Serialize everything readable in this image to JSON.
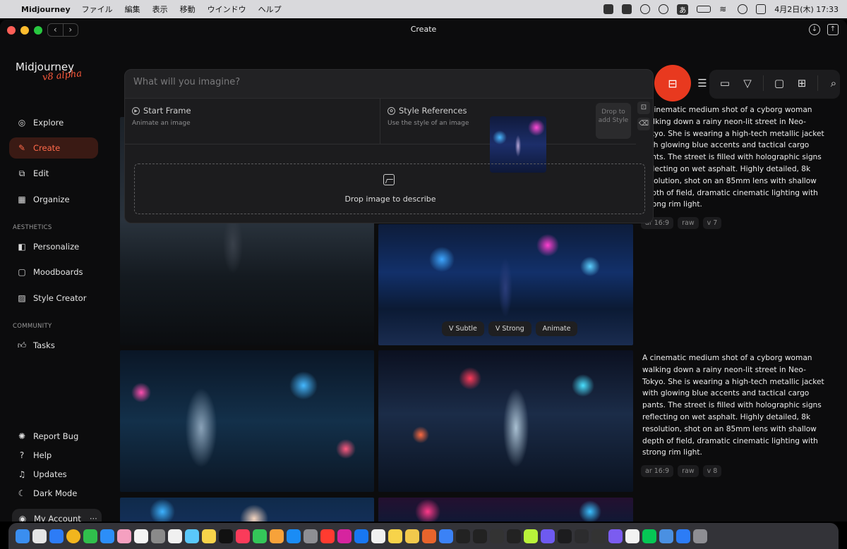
{
  "menubar": {
    "app_name": "Midjourney",
    "menus": [
      "ファイル",
      "編集",
      "表示",
      "移動",
      "ウインドウ",
      "ヘルプ"
    ],
    "input_indicator": "あ",
    "datetime": "4月2日(木)  17:33"
  },
  "window": {
    "title": "Create"
  },
  "sidebar": {
    "logo": "Midjourney",
    "logo_badge": "v8 alpha",
    "main_items": [
      {
        "label": "Explore",
        "icon": "compass-icon"
      },
      {
        "label": "Create",
        "icon": "brush-icon",
        "active": true
      },
      {
        "label": "Edit",
        "icon": "edit-icon"
      },
      {
        "label": "Organize",
        "icon": "grid-icon"
      }
    ],
    "aesthetics_label": "AESTHETICS",
    "aesthetics_items": [
      {
        "label": "Personalize",
        "icon": "personalize-icon"
      },
      {
        "label": "Moodboards",
        "icon": "moodboard-icon"
      },
      {
        "label": "Style Creator",
        "icon": "style-creator-icon"
      }
    ],
    "community_label": "COMMUNITY",
    "community_items": [
      {
        "label": "Tasks",
        "icon": "thumbs-up-icon"
      }
    ],
    "bottom_items": [
      {
        "label": "Report Bug",
        "icon": "bug-icon"
      },
      {
        "label": "Help",
        "icon": "help-icon"
      },
      {
        "label": "Updates",
        "icon": "bell-icon"
      },
      {
        "label": "Dark Mode",
        "icon": "moon-icon"
      }
    ],
    "account": {
      "label": "My Account",
      "more": "···"
    }
  },
  "imagine": {
    "placeholder": "What will you imagine?",
    "start_frame": {
      "title": "Start Frame",
      "subtitle": "Animate an image"
    },
    "style_refs": {
      "title": "Style References",
      "subtitle": "Use the style of an image",
      "drop_label": "Drop to add Style"
    },
    "describe_label": "Drop image to describe"
  },
  "toolbar": {
    "icons": [
      "image-prompt-icon",
      "sliders-icon",
      "folder-icon",
      "filter-icon",
      "chat-icon",
      "grid-view-icon",
      "search-icon"
    ]
  },
  "feed": {
    "prompts": [
      {
        "text": "A cinematic medium shot of a cyborg woman walking down a rainy neon-lit street in Neo-Tokyo. She is wearing a high-tech metallic jacket with glowing blue accents and tactical cargo pants. The street is filled with holographic signs reflecting on wet asphalt. Highly detailed, 8k resolution, shot on an 85mm lens with shallow depth of field, dramatic cinematic lighting with strong rim light.",
        "tags": [
          "ar 16:9",
          "raw",
          "v 7"
        ]
      },
      {
        "text": "A cinematic medium shot of a cyborg woman walking down a rainy neon-lit street in Neo-Tokyo. She is wearing a high-tech metallic jacket with glowing blue accents and tactical cargo pants. The street is filled with holographic signs reflecting on wet asphalt. Highly detailed, 8k resolution, shot on an 85mm lens with shallow depth of field, dramatic cinematic lighting with strong rim light.",
        "tags": [
          "ar 16:9",
          "raw",
          "v 8"
        ]
      }
    ],
    "image_actions": [
      "V Subtle",
      "V Strong",
      "Animate"
    ]
  }
}
